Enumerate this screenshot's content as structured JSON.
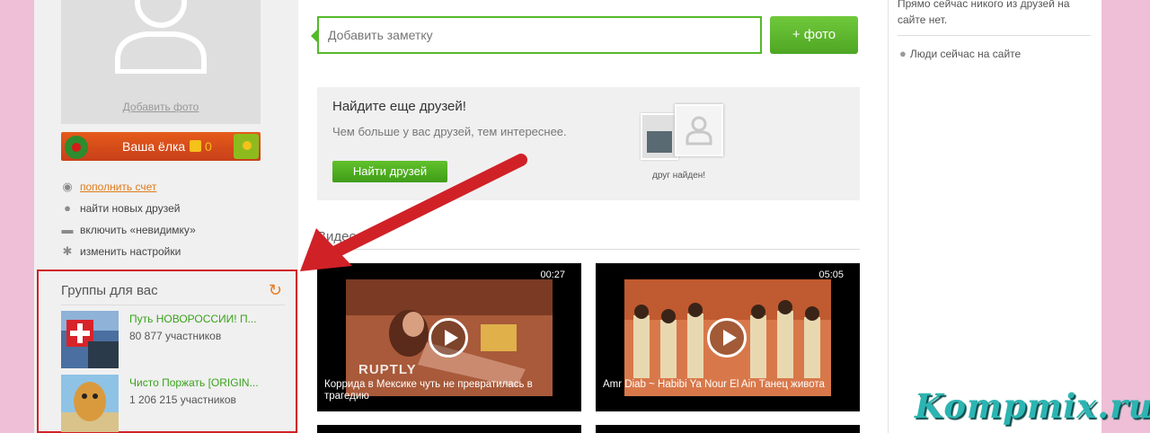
{
  "profile": {
    "add_photo": "Добавить фото"
  },
  "elka": {
    "label": "Ваша ёлка",
    "count": "0"
  },
  "menu": [
    {
      "label": "пополнить счет",
      "icon": "coin-icon"
    },
    {
      "label": "найти новых друзей",
      "icon": "user-icon"
    },
    {
      "label": "включить «невидимку»",
      "icon": "hat-icon"
    },
    {
      "label": "изменить настройки",
      "icon": "gear-icon"
    }
  ],
  "groups": {
    "title": "Группы для вас",
    "items": [
      {
        "name": "Путь НОВОРОССИИ! П...",
        "members": "80 877 участников"
      },
      {
        "name": "Чисто Поржать [ORIGIN...",
        "members": "1 206 215 участников"
      }
    ]
  },
  "note": {
    "placeholder": "Добавить заметку"
  },
  "photo_button": "+ фото",
  "friends": {
    "title": "Найдите еще друзей!",
    "description": "Чем больше у вас друзей, тем интереснее.",
    "button": "Найти друзей",
    "found": "друг найден!"
  },
  "videos": {
    "title": "Видео",
    "items": [
      {
        "duration": "00:27",
        "caption": "Коррида в Мексике чуть не превратилась в трагедию",
        "brand": "RUPTLY"
      },
      {
        "duration": "05:05",
        "caption": "Amr Diab ~ Habibi Ya Nour El Ain Танец живота"
      }
    ]
  },
  "right": {
    "online_text": "Прямо сейчас никого из друзей на сайте нет.",
    "people_online": "Люди сейчас на сайте"
  },
  "watermark": "Kompmix.ru",
  "colors": {
    "accent_green": "#55b92a",
    "annotation_red": "#d02127",
    "link_orange": "#e07b1a"
  }
}
